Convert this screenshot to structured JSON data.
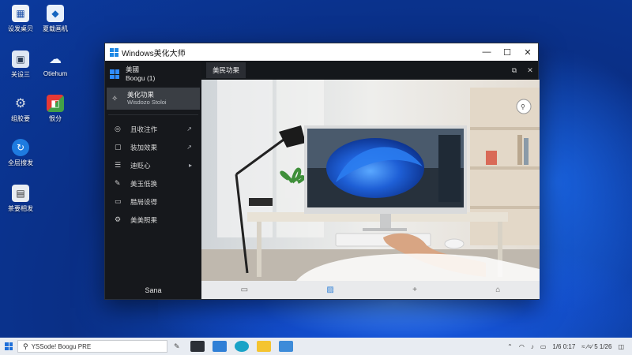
{
  "desktop": {
    "icons": [
      {
        "label": "设发桌贝",
        "icon": "this-pc-icon"
      },
      {
        "label": "夏载画机",
        "icon": "shield-app-icon"
      },
      {
        "label": "关设三",
        "icon": "network-icon"
      },
      {
        "label": "Otiehum",
        "icon": "cloud-icon"
      },
      {
        "label": "组胶要",
        "icon": "settings-gear-icon"
      },
      {
        "label": "恨分",
        "icon": "store-icon"
      },
      {
        "label": "全层搜发",
        "icon": "sync-icon"
      },
      {
        "label": "茶要相发",
        "icon": "calculator-icon"
      }
    ]
  },
  "window": {
    "title": "Windows美化大师",
    "controls": {
      "minimize": "—",
      "maximize": "☐",
      "close": "✕"
    },
    "account": {
      "name": "美國",
      "sub": "Boogu (1)"
    },
    "selected": {
      "label": "美化功果",
      "sub": "Wisdozo Stoloi"
    },
    "nav": [
      {
        "label": "且收注作",
        "icon": "circle-icon",
        "chevron": "↗"
      },
      {
        "label": "装加效果",
        "icon": "box-icon",
        "chevron": "↗"
      },
      {
        "label": "迪贬心",
        "icon": "list-icon",
        "chevron": "▸"
      },
      {
        "label": "美玉低换",
        "icon": "brush-icon",
        "chevron": ""
      },
      {
        "label": "腊局设得",
        "icon": "folder-icon",
        "chevron": ""
      },
      {
        "label": "美美照果",
        "icon": "gear-icon",
        "chevron": ""
      }
    ],
    "user": "Sana",
    "tab": "美民功果",
    "tab_icons": {
      "folder": "⧉",
      "close": "✕"
    },
    "bottom_icons": {
      "screen": "▭",
      "gallery": "▨",
      "add": "+",
      "home": "⌂"
    }
  },
  "taskbar": {
    "search_text": "YSSode! Boogu PRE",
    "tray_text": "1/6 0:17",
    "tray_date": "≈ ∕≈∕ 5 1/26"
  },
  "colors": {
    "accent": "#2f8cff",
    "wallpaper": "#0d3fa8"
  }
}
